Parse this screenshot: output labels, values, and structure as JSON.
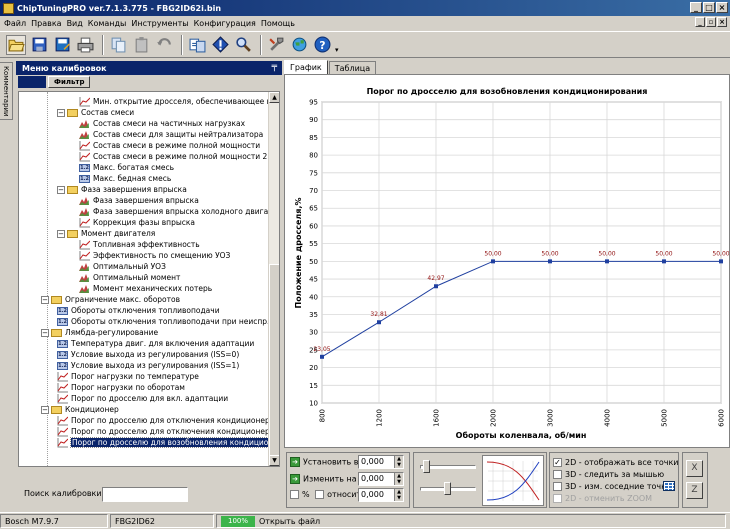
{
  "window": {
    "title": "ChipTuningPRO ver.7.1.3.775 - FBG2ID62i.bin",
    "min": "_",
    "max": "□",
    "close": "×"
  },
  "menu": [
    "Файл",
    "Правка",
    "Вид",
    "Команды",
    "Инструменты",
    "Конфигурация",
    "Помощь"
  ],
  "toolbar": [
    "open-folder-icon",
    "save-icon",
    "save-as-icon",
    "print-icon",
    "copy-icon",
    "paste-icon",
    "undo-icon",
    "compare-icon",
    "checksum-icon",
    "search-icon",
    "tools-icon",
    "globe-icon",
    "help-icon"
  ],
  "side_tab": "Комментарии",
  "panel": {
    "title": "Меню калибровок",
    "pin": "╤",
    "filter": "Фильтр"
  },
  "tree": [
    {
      "level": 3,
      "icon": "curve",
      "label": "Мин. открытие дросселя, обеспечивающее ма"
    },
    {
      "level": 2,
      "icon": "folder",
      "pm": "−",
      "label": "Состав смеси"
    },
    {
      "level": 3,
      "icon": "map",
      "label": "Состав смеси на частичных нагрузках"
    },
    {
      "level": 3,
      "icon": "map",
      "label": "Состав смеси для защиты нейтрализатора"
    },
    {
      "level": 3,
      "icon": "curve",
      "label": "Состав смеси в режиме полной мощности"
    },
    {
      "level": 3,
      "icon": "curve",
      "label": "Состав смеси в режиме полной мощности 2"
    },
    {
      "level": 3,
      "icon": "value",
      "label": "Макс. богатая смесь"
    },
    {
      "level": 3,
      "icon": "value",
      "label": "Макс. бедная смесь"
    },
    {
      "level": 2,
      "icon": "folder",
      "pm": "−",
      "label": "Фаза завершения впрыска"
    },
    {
      "level": 3,
      "icon": "map",
      "label": "Фаза завершения впрыска"
    },
    {
      "level": 3,
      "icon": "map",
      "label": "Фаза завершения впрыска холодного двигате"
    },
    {
      "level": 3,
      "icon": "curve",
      "label": "Коррекция фазы впрыска"
    },
    {
      "level": 2,
      "icon": "folder",
      "pm": "−",
      "label": "Момент двигателя"
    },
    {
      "level": 3,
      "icon": "curve",
      "label": "Топливная эффективность"
    },
    {
      "level": 3,
      "icon": "curve",
      "label": "Эффективность по смещению УОЗ"
    },
    {
      "level": 3,
      "icon": "map",
      "label": "Оптимальный УОЗ"
    },
    {
      "level": 3,
      "icon": "map",
      "label": "Оптимальный момент"
    },
    {
      "level": 3,
      "icon": "map",
      "label": "Момент механических потерь"
    },
    {
      "level": 1,
      "icon": "folder",
      "pm": "−",
      "label": "Ограничение макс. оборотов"
    },
    {
      "level": 2,
      "icon": "value",
      "label": "Обороты отключения топливоподачи"
    },
    {
      "level": 2,
      "icon": "value",
      "label": "Обороты отключения топливоподачи при неиспр. Д"
    },
    {
      "level": 1,
      "icon": "folder",
      "pm": "−",
      "label": "Лямбда-регулирование"
    },
    {
      "level": 2,
      "icon": "value",
      "label": "Температура двиг. для включения адаптации"
    },
    {
      "level": 2,
      "icon": "value",
      "label": "Условие выхода из регулирования (ISS=0)"
    },
    {
      "level": 2,
      "icon": "value",
      "label": "Условие выхода из регулирования (ISS=1)"
    },
    {
      "level": 2,
      "icon": "curve",
      "label": "Порог нагрузки по температуре"
    },
    {
      "level": 2,
      "icon": "curve",
      "label": "Порог нагрузки по оборотам"
    },
    {
      "level": 2,
      "icon": "curve",
      "label": "Порог по дросселю для вкл. адаптации"
    },
    {
      "level": 1,
      "icon": "folder",
      "pm": "−",
      "label": "Кондиционер"
    },
    {
      "level": 2,
      "icon": "curve",
      "label": "Порог по дросселю для отключения кондиционеро"
    },
    {
      "level": 2,
      "icon": "curve",
      "label": "Порог по дросселю для отключения кондиционеро"
    },
    {
      "level": 2,
      "icon": "curve",
      "label": "Порог по дросселю для возобновления кондицион",
      "selected": true
    }
  ],
  "search": {
    "label": "Поиск калибровки",
    "value": ""
  },
  "tabs": [
    "График",
    "Таблица"
  ],
  "chart_data": {
    "type": "line",
    "title": "Порог по дросселю для возобновления кондиционирования",
    "xlabel": "Обороты коленвала, об/мин",
    "ylabel": "Положение дросселя,%",
    "categories": [
      "800",
      "1200",
      "1600",
      "2000",
      "3000",
      "4000",
      "5000",
      "6000"
    ],
    "values": [
      23.05,
      32.81,
      42.97,
      50.0,
      50.0,
      50.0,
      50.0,
      50.0
    ],
    "point_labels": [
      "23,05",
      "32,81",
      "42,97",
      "50,00",
      "50,00",
      "50,00",
      "50,00",
      "50,00"
    ],
    "ylim": [
      10,
      95
    ],
    "yticks": [
      10,
      15,
      20,
      25,
      30,
      35,
      40,
      45,
      50,
      55,
      60,
      65,
      70,
      75,
      80,
      85,
      90,
      95
    ],
    "grid": true,
    "line_color": "#2040a0",
    "label_color": "#901010"
  },
  "controls": {
    "set_label": "Установить в",
    "set_value": "0,000",
    "change_label": "Изменить на",
    "change_value": "0,000",
    "percent_label": "%",
    "relative_label": "относит.",
    "relative_value": "0,000",
    "opt_2d": "2D - отображать все точки",
    "opt_3d_mouse": "3D - следить за мышью",
    "opt_3d_neighbors": "3D - изм. соседние точки",
    "opt_2d_zoom": "2D - отменить ZOOM",
    "btn_x": "X",
    "btn_z": "Z"
  },
  "status": {
    "ecu": "Bosch M7.9.7",
    "file": "FBG2ID62",
    "progress": "100%",
    "message": "Открыть файл"
  }
}
